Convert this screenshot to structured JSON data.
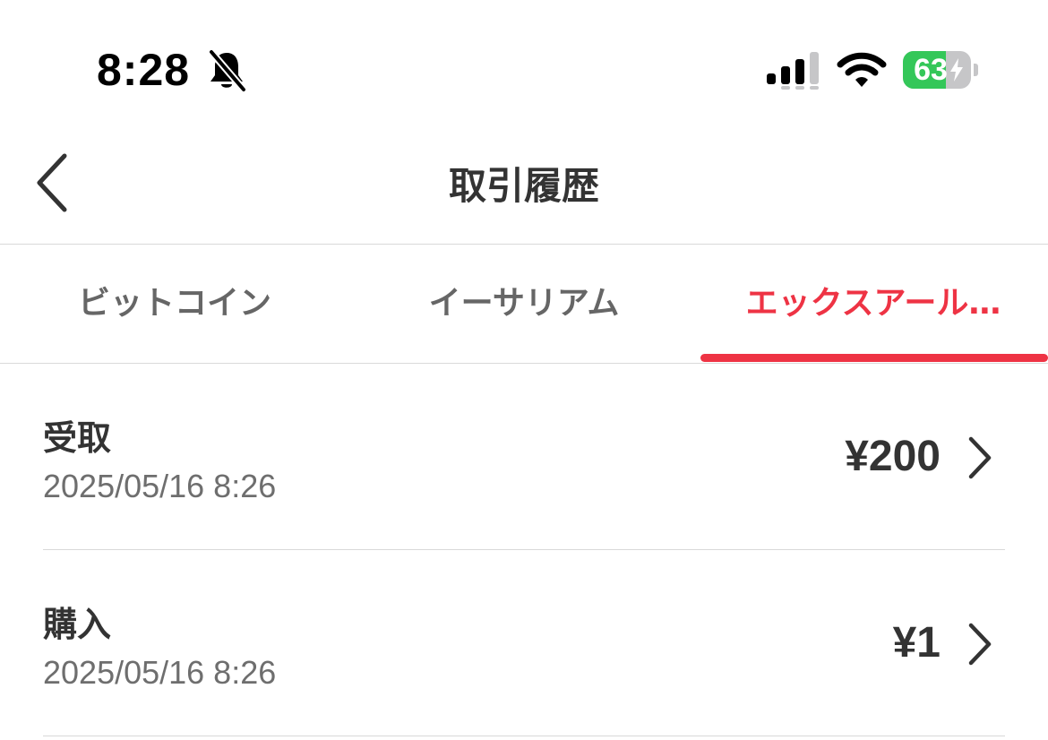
{
  "status_bar": {
    "time": "8:28",
    "battery_percent": "63",
    "battery_level": 0.63,
    "icons": [
      "bell-slash-icon",
      "cellular-signal-icon",
      "wifi-icon",
      "battery-charging-icon"
    ]
  },
  "nav": {
    "title": "取引履歴",
    "back_icon": "chevron-left-icon"
  },
  "tabs": [
    {
      "label": "ビットコイン",
      "active": false
    },
    {
      "label": "イーサリアム",
      "active": false
    },
    {
      "label": "エックスアール…",
      "active": true
    }
  ],
  "transactions": [
    {
      "type": "受取",
      "date": "2025/05/16 8:26",
      "amount": "¥200"
    },
    {
      "type": "購入",
      "date": "2025/05/16 8:26",
      "amount": "¥1"
    }
  ],
  "colors": {
    "accent": "#ee3344",
    "battery_green": "#34c759",
    "text_primary": "#333333",
    "text_secondary": "#6e6e6e",
    "divider": "#d9d9d9"
  }
}
